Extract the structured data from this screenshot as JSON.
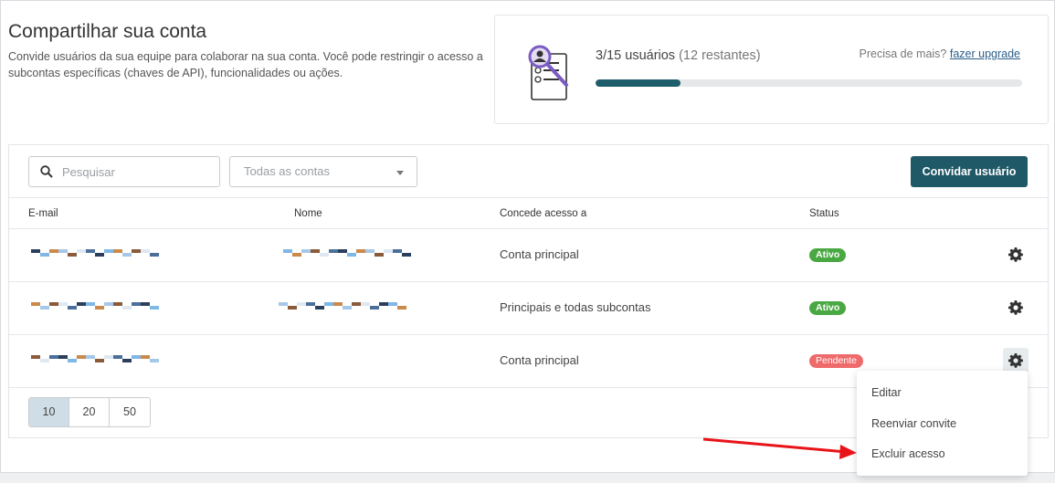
{
  "header": {
    "title": "Compartilhar sua conta",
    "description": "Convide usuários da sua equipe para colaborar na sua conta. Você pode restringir o acesso a subcontas específicas (chaves de API), funcionalidades ou ações."
  },
  "usage": {
    "count_label": "3/15 usuários",
    "remaining_label": "(12 restantes)",
    "progress_fraction": 0.2,
    "upgrade_prompt": "Precisa de mais?",
    "upgrade_link": "fazer upgrade",
    "icon": "user-profile-magnifier-icon"
  },
  "toolbar": {
    "search_placeholder": "Pesquisar",
    "accounts_select_value": "Todas as contas",
    "invite_button": "Convidar usuário"
  },
  "table": {
    "columns": [
      "E-mail",
      "Nome",
      "Concede acesso a",
      "Status"
    ],
    "rows": [
      {
        "email": "",
        "name": "",
        "access": "Conta principal",
        "status": "Ativo"
      },
      {
        "email": "",
        "name": "",
        "access": "Principais e todas subcontas",
        "status": "Ativo"
      },
      {
        "email": "",
        "name": "",
        "access": "Conta principal",
        "status": "Pendente"
      }
    ]
  },
  "pagination": {
    "options": [
      "10",
      "20",
      "50"
    ],
    "selected": "10"
  },
  "row_menu": {
    "items": [
      "Editar",
      "Reenviar convite",
      "Excluir acesso"
    ]
  },
  "colors": {
    "primary": "#1f5866",
    "active_badge": "#4aa843",
    "pending_badge": "#ef6a6a",
    "annotation_arrow": "#e8141a"
  }
}
